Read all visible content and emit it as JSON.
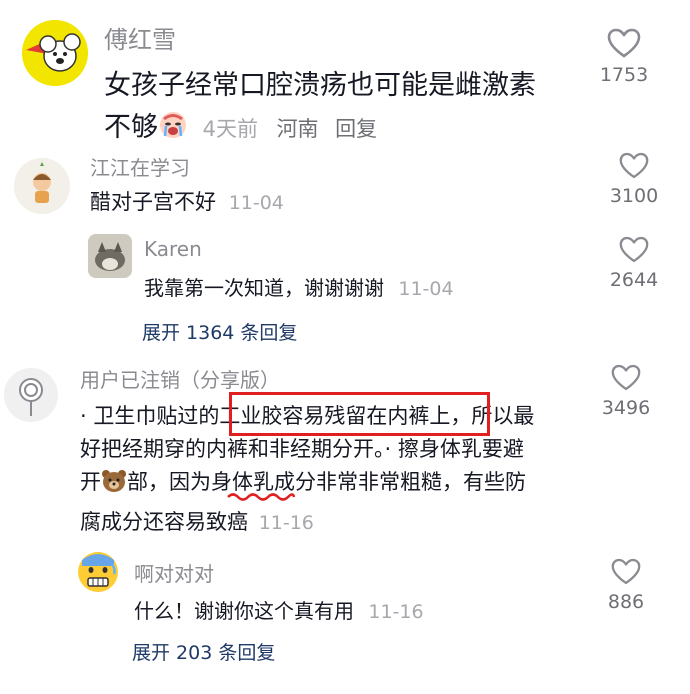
{
  "comments": [
    {
      "author": "傅红雪",
      "text_line1": "女孩子经常口腔溃疡也可能是雌激素",
      "text_line2": "不够",
      "emoji": "crying-face-emoji",
      "time": "4天前",
      "location": "河南",
      "reply": "回复",
      "likes": "1753"
    },
    {
      "author": "江江在学习",
      "text": "醋对子宫不好",
      "time": "11-04",
      "likes": "3100",
      "replies": [
        {
          "author": "Karen",
          "text": "我靠第一次知道，谢谢谢谢",
          "time": "11-04",
          "likes": "2644"
        }
      ],
      "expand_label": "展开 1364 条回复"
    },
    {
      "author": "用户已注销（分享版）",
      "line1_pre": "· 卫生巾贴过的",
      "line1_boxed": "工业胶容易残留在内裤上",
      "line1_post": "，所以最",
      "line2": "好把经期穿的内裤和非经期分开。· 擦身体乳要避",
      "line3_pre": "开",
      "line3_post": "部，因为",
      "line3_underlined": "身体乳",
      "line3_end": "成分非常非常粗糙，有些防",
      "line4": "腐成分还容易致癌",
      "time": "11-16",
      "likes": "3496",
      "replies": [
        {
          "author": "啊对对对",
          "text": "什么！谢谢你这个真有用",
          "time": "11-16",
          "likes": "886"
        }
      ],
      "expand_label": "展开 203 条回复"
    }
  ],
  "colors": {
    "name": "#8a8b91",
    "meta": "#a7a8ad",
    "expand": "#1f3a66",
    "highlight_box": "#e02020"
  }
}
